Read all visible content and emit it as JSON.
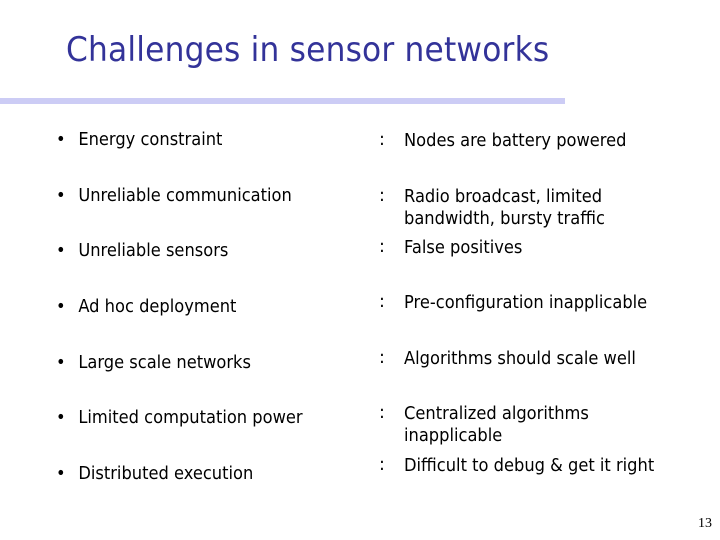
{
  "slide": {
    "title": "Challenges in sensor networks",
    "page_number": "13",
    "colors": {
      "title": "#333399",
      "rule": "#ccccf5"
    },
    "rows": [
      {
        "challenge": "Energy constraint",
        "separator": ":",
        "description": [
          "Nodes are battery powered"
        ]
      },
      {
        "challenge": "Unreliable communication",
        "separator": ":",
        "description": [
          "Radio broadcast, limited",
          "bandwidth, bursty traffic"
        ]
      },
      {
        "challenge": "Unreliable sensors",
        "separator": ":",
        "description": [
          "False positives"
        ]
      },
      {
        "challenge": "Ad hoc deployment",
        "separator": ":",
        "description": [
          "Pre-configuration inapplicable"
        ]
      },
      {
        "challenge": "Large scale networks",
        "separator": ":",
        "description": [
          "Algorithms should scale well"
        ]
      },
      {
        "challenge": "Limited computation power",
        "separator": ":",
        "description": [
          "Centralized algorithms",
          "inapplicable"
        ]
      },
      {
        "challenge": "Distributed execution",
        "separator": ":",
        "description": [
          "Difficult to debug & get it right"
        ]
      }
    ],
    "bullet_glyph": "•"
  }
}
